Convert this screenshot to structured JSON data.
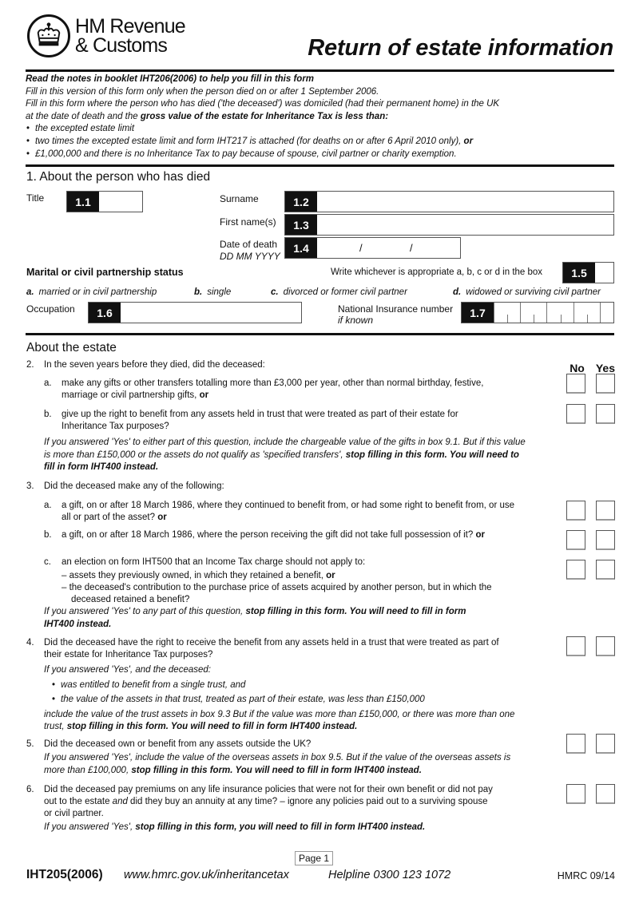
{
  "header": {
    "org_line1": "HM Revenue",
    "org_line2": "& Customs",
    "logo_icon": "royal-crown-icon",
    "title": "Return of estate information"
  },
  "intro": {
    "line1": "Read the notes in booklet IHT206(2006) to help you fill in this form",
    "line2": "Fill in this version of this form only when the person died on or after 1 September 2006.",
    "line3": "Fill in this form where the person who has died ('the deceased') was domiciled (had their permanent home) in the UK",
    "line4_prefix": "at the date of death and the ",
    "line4_bold": "gross value of the estate for Inheritance Tax is less than:",
    "bullets": [
      {
        "text": "the excepted estate limit",
        "bold": ""
      },
      {
        "text": "two times the excepted estate limit and form IHT217 is attached (for deaths on or after 6 April 2010 only), ",
        "bold": "or"
      },
      {
        "text": "£1,000,000 and there is no Inheritance Tax to pay because of spouse, civil partner or charity exemption.",
        "bold": ""
      }
    ]
  },
  "section1": {
    "title": "1. About the person who has died",
    "title_label": "Title",
    "box_1_1": "1.1",
    "title_value": "",
    "surname_label": "Surname",
    "box_1_2": "1.2",
    "surname_value": "",
    "first_names_label": "First name(s)",
    "box_1_3": "1.3",
    "first_names_value": "",
    "dod_label": "Date of death",
    "dod_format": "DD MM YYYY",
    "box_1_4": "1.4",
    "dod_sep": "/",
    "marital_heading": "Marital or civil partnership status",
    "marital_instruction": "Write whichever is appropriate a, b, c or d in the box",
    "box_1_5": "1.5",
    "marital_value": "",
    "marital_options": [
      {
        "key": "a.",
        "text": "married or in civil partnership"
      },
      {
        "key": "b.",
        "text": "single"
      },
      {
        "key": "c.",
        "text": "divorced or former civil partner"
      },
      {
        "key": "d.",
        "text": "widowed or surviving civil partner"
      }
    ],
    "occupation_label": "Occupation",
    "box_1_6": "1.6",
    "occupation_value": "",
    "ni_label": "National Insurance number",
    "ni_sub": "if known",
    "box_1_7": "1.7",
    "ni_value": ""
  },
  "estate": {
    "title": "About the estate",
    "col_no": "No",
    "col_yes": "Yes",
    "q2": {
      "num": "2.",
      "text": "In the seven years before they died, did the deceased:",
      "a_key": "a.",
      "a_text": "make any gifts or other transfers totalling more than £3,000 per year, other than normal birthday, festive,",
      "a_text2": "marriage or civil partnership gifts, ",
      "a_bold": "or",
      "b_key": "b.",
      "b_text": "give up the right to benefit from any assets held in trust that were treated as part of their estate for",
      "b_text2": "Inheritance Tax purposes?",
      "note1": "If you answered 'Yes' to either part of this question, include the chargeable value of the gifts in box 9.1. But if this value",
      "note2": "is more than £150,000 or the assets do not qualify as 'specified transfers', ",
      "note2_bold": "stop filling in this form. You will need to",
      "note3_bold": "fill in form IHT400 instead."
    },
    "q3": {
      "num": "3.",
      "text": "Did the deceased make any of the following:",
      "a_key": "a.",
      "a_text": "a gift, on or after 18 March 1986, where they continued to benefit from, or had some right to benefit from, or use",
      "a_text2": "all or part of the asset? ",
      "a_bold": "or",
      "b_key": "b.",
      "b_text": "a gift, on or after 18 March 1986, where the person receiving the gift did not take full possession of it? ",
      "b_bold": "or",
      "c_key": "c.",
      "c_text": "an election on form IHT500 that an Income Tax charge should not apply to:",
      "c_dash1": "– assets they previously owned, in which they retained a benefit, ",
      "c_dash1_bold": "or",
      "c_dash2": "– the deceased's contribution to the purchase price of assets acquired by another person, but in which the",
      "c_dash2b": "deceased retained a benefit?",
      "note1": "If you answered 'Yes' to any part of this question, ",
      "note1_bold": "stop filling in this form. You will need to fill in form",
      "note2_bold": "IHT400 instead."
    },
    "q4": {
      "num": "4.",
      "text": "Did the deceased have the right to receive the benefit from any assets held in a trust that were treated as part of",
      "text2": "their estate for Inheritance Tax purposes?",
      "note_intro": "If you answered 'Yes', and the deceased:",
      "bullets": [
        "was entitled to benefit from a single trust, and",
        "the value of the assets in that trust, treated as part of their estate, was less than £150,000"
      ],
      "note1": "include the value of the trust assets in box 9.3 But if the value was more than £150,000, or there was more than one",
      "note2": "trust, ",
      "note2_bold": "stop filling in this form. You will need to fill in form IHT400 instead."
    },
    "q5": {
      "num": "5.",
      "text": "Did the deceased own or benefit from any assets outside the UK?",
      "note1": "If you answered 'Yes', include the value of the overseas assets in box 9.5. But if the value of the overseas assets is",
      "note2": "more than £100,000, ",
      "note2_bold": "stop filling in this form. You will need to fill in form IHT400 instead."
    },
    "q6": {
      "num": "6.",
      "text": "Did the deceased pay premiums on any life insurance policies that were not for their own benefit or did not pay",
      "text2a": "out to the estate ",
      "text2_italic": "and",
      "text2b": " did they buy an annuity at any time? – ignore any policies paid out to a surviving spouse",
      "text3": "or civil partner.",
      "note1": "If you answered 'Yes', ",
      "note1_bold": "stop filling in this form, you will need to fill in form IHT400 instead."
    }
  },
  "footer": {
    "page": "Page  1",
    "form_code": "IHT205(2006)",
    "url": "www.hmrc.gov.uk/inheritancetax",
    "helpline": "Helpline 0300 123 1072",
    "version": "HMRC 09/14"
  }
}
